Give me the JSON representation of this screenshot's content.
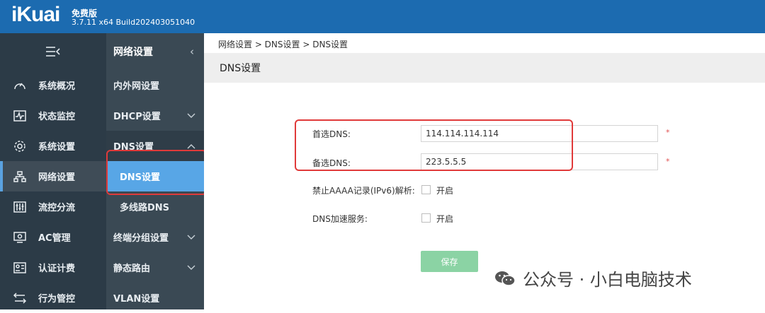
{
  "header": {
    "logo": "iKuai",
    "edition": "免费版",
    "version": "3.7.11 x64 Build202403051040"
  },
  "sidebar": {
    "toggle_icon": "menu-collapse-icon",
    "items": [
      {
        "label": "系统概况",
        "icon": "dashboard-icon"
      },
      {
        "label": "状态监控",
        "icon": "monitor-icon"
      },
      {
        "label": "系统设置",
        "icon": "gear-icon"
      },
      {
        "label": "网络设置",
        "icon": "network-icon"
      },
      {
        "label": "流控分流",
        "icon": "sliders-icon"
      },
      {
        "label": "AC管理",
        "icon": "ac-icon"
      },
      {
        "label": "认证计费",
        "icon": "id-card-icon"
      },
      {
        "label": "行为管控",
        "icon": "swap-icon"
      }
    ],
    "active_item": "网络设置"
  },
  "subnav": {
    "title": "网络设置",
    "items": [
      {
        "label": "内外网设置"
      },
      {
        "label": "DHCP设置"
      },
      {
        "label": "DNS设置"
      },
      {
        "label": "DNS设置"
      },
      {
        "label": "多线路DNS"
      },
      {
        "label": "终端分组设置"
      },
      {
        "label": "静态路由"
      },
      {
        "label": "VLAN设置"
      }
    ]
  },
  "main": {
    "breadcrumb": "网络设置 > DNS设置 > DNS设置",
    "title": "DNS设置",
    "form": {
      "primary_dns_label": "首选DNS:",
      "primary_dns_value": "114.114.114.114",
      "secondary_dns_label": "备选DNS:",
      "secondary_dns_value": "223.5.5.5",
      "required_mark": "*",
      "aaaa_label": "禁止AAAA记录(IPv6)解析:",
      "aaaa_option": "开启",
      "accel_label": "DNS加速服务:",
      "accel_option": "开启",
      "save_label": "保存"
    }
  },
  "watermark": {
    "text": "公众号 · 小白电脑技术"
  },
  "colors": {
    "topbar": "#1c6bb0",
    "sidebar": "#2c3b47",
    "subnav": "#3a4954",
    "selected": "#58a6e6",
    "highlight": "#e03a3a",
    "save_button": "#8bd3a4"
  }
}
